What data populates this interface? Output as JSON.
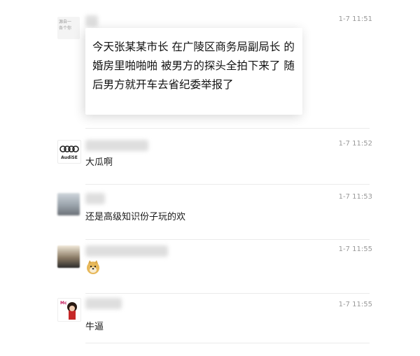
{
  "messages": [
    {
      "name_blurred": true,
      "name_fragment": "",
      "time": "1-7 11:51",
      "text": "今天张某某市长 在广陵区商务局副局长 的婚房里啪啪啪 被男方的探头全拍下来了 随后男方就开车去省纪委举报了"
    },
    {
      "name_blurred": true,
      "avatar_label": "AudiSE",
      "time": "1-7 11:52",
      "text": "大瓜啊"
    },
    {
      "name_blurred": true,
      "time": "1-7 11:53",
      "text": "还是高级知识份子玩的欢"
    },
    {
      "name_blurred": true,
      "time": "1-7 11:55",
      "text": "",
      "sticker": "doge-emoji"
    },
    {
      "name_blurred": true,
      "avatar_label": "Mc",
      "time": "1-7 11:55",
      "text": "牛逼"
    }
  ],
  "colors": {
    "background": "#ffffff",
    "time": "#999999",
    "divider": "#ebebeb",
    "bubble_shadow": "rgba(0,0,0,0.16)"
  }
}
